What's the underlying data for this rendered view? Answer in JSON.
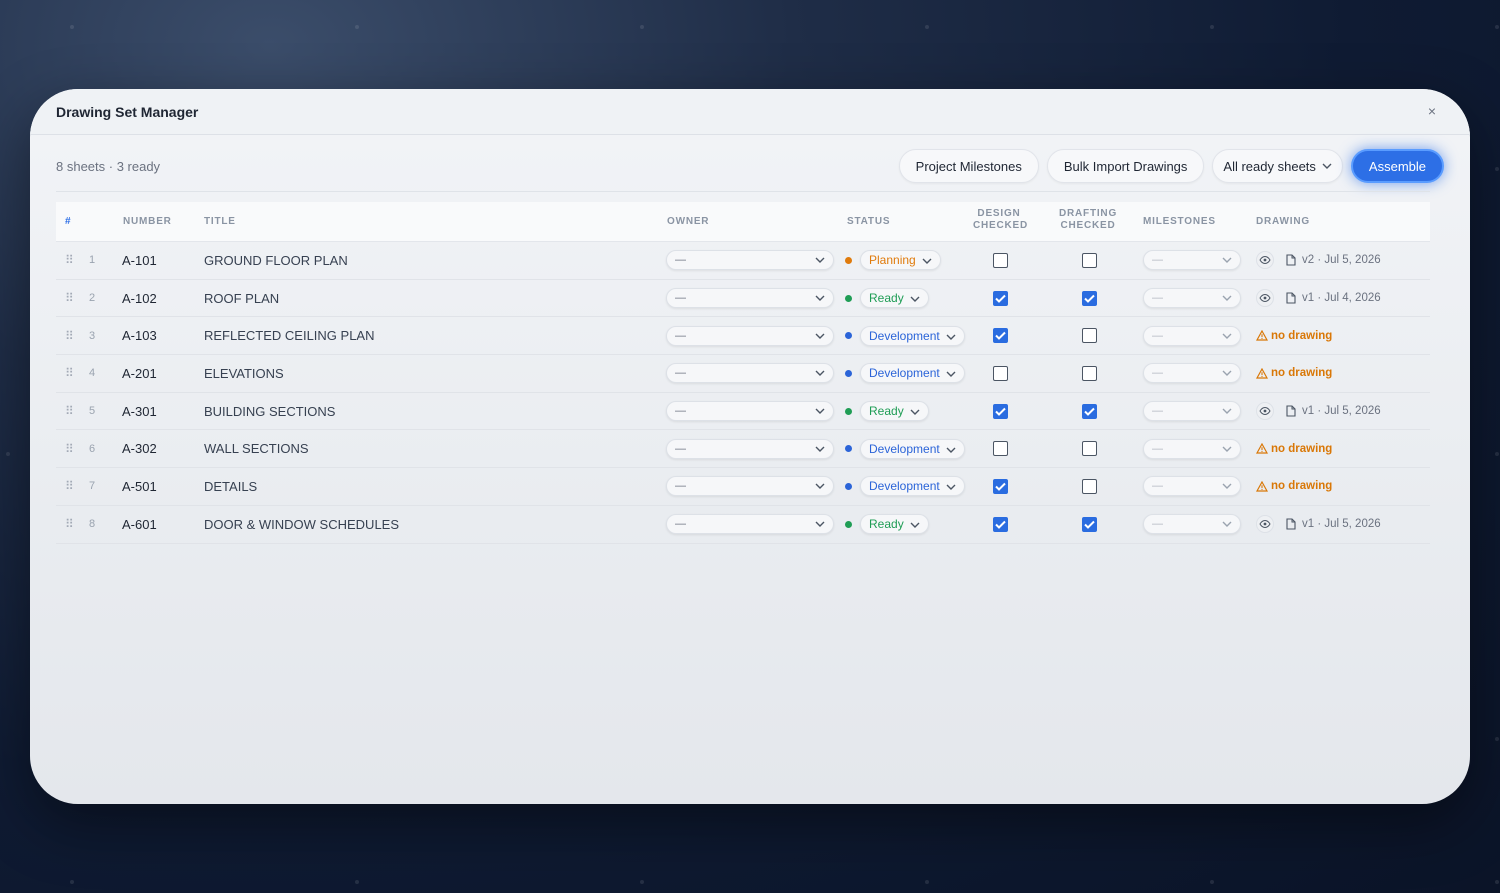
{
  "window": {
    "title": "Drawing Set Manager",
    "close_label": "×"
  },
  "toolbar": {
    "summary": "8 sheets · 3 ready",
    "milestones_label": "Project Milestones",
    "import_label": "Bulk Import Drawings",
    "scope_label": "All ready sheets",
    "assemble_label": "Assemble"
  },
  "headers": {
    "hash": "#",
    "number": "NUMBER",
    "title": "TITLE",
    "owner": "OWNER",
    "status": "STATUS",
    "design_checked": [
      "DESIGN",
      "CHECKED"
    ],
    "drafting_checked": [
      "DRAFTING",
      "CHECKED"
    ],
    "milestones": "MILESTONES",
    "drawing": "DRAWING"
  },
  "colors": {
    "accent": "#2d6fe6",
    "planning": "#e07b0c",
    "ready": "#1f9d55",
    "development": "#2b64d8",
    "warning": "#d97706"
  },
  "rows": [
    {
      "index": "1",
      "number": "A-101",
      "title": "GROUND FLOOR PLAN",
      "owner": "—",
      "status": "Planning",
      "status_color": "#e07b0c",
      "design_checked": false,
      "drafting_checked": false,
      "milestones": "—",
      "drawing": "v2 · Jul 5, 2026",
      "has_drawing": true
    },
    {
      "index": "2",
      "number": "A-102",
      "title": "ROOF PLAN",
      "owner": "—",
      "status": "Ready",
      "status_color": "#1f9d55",
      "design_checked": true,
      "drafting_checked": true,
      "milestones": "—",
      "drawing": "v1 · Jul 4, 2026",
      "has_drawing": true
    },
    {
      "index": "3",
      "number": "A-103",
      "title": "REFLECTED CEILING PLAN",
      "owner": "—",
      "status": "Development",
      "status_color": "#2b64d8",
      "design_checked": true,
      "drafting_checked": false,
      "milestones": "—",
      "drawing": "no drawing",
      "has_drawing": false
    },
    {
      "index": "4",
      "number": "A-201",
      "title": "ELEVATIONS",
      "owner": "—",
      "status": "Development",
      "status_color": "#2b64d8",
      "design_checked": false,
      "drafting_checked": false,
      "milestones": "—",
      "drawing": "no drawing",
      "has_drawing": false
    },
    {
      "index": "5",
      "number": "A-301",
      "title": "BUILDING SECTIONS",
      "owner": "—",
      "status": "Ready",
      "status_color": "#1f9d55",
      "design_checked": true,
      "drafting_checked": true,
      "milestones": "—",
      "drawing": "v1 · Jul 5, 2026",
      "has_drawing": true
    },
    {
      "index": "6",
      "number": "A-302",
      "title": "WALL SECTIONS",
      "owner": "—",
      "status": "Development",
      "status_color": "#2b64d8",
      "design_checked": false,
      "drafting_checked": false,
      "milestones": "—",
      "drawing": "no drawing",
      "has_drawing": false
    },
    {
      "index": "7",
      "number": "A-501",
      "title": "DETAILS",
      "owner": "—",
      "status": "Development",
      "status_color": "#2b64d8",
      "design_checked": true,
      "drafting_checked": false,
      "milestones": "—",
      "drawing": "no drawing",
      "has_drawing": false
    },
    {
      "index": "8",
      "number": "A-601",
      "title": "DOOR & WINDOW SCHEDULES",
      "owner": "—",
      "status": "Ready",
      "status_color": "#1f9d55",
      "design_checked": true,
      "drafting_checked": true,
      "milestones": "—",
      "drawing": "v1 · Jul 5, 2026",
      "has_drawing": true
    }
  ]
}
